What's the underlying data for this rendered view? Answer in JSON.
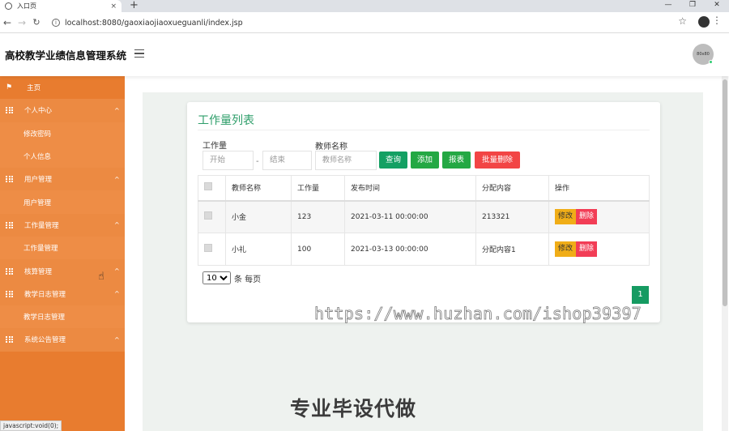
{
  "browser": {
    "tab_title": "入口页",
    "tab_close": "×",
    "new_tab": "+",
    "window_controls": [
      "—",
      "❐",
      "✕"
    ],
    "back": "←",
    "forward": "→",
    "reload": "C",
    "url": "localhost:8080/gaoxiaojiaoxueguanli/index.jsp",
    "star": "☆",
    "menu": "⋮",
    "status_url": "javascript:void(0);"
  },
  "header": {
    "brand": "高校教学业绩信息管理系统",
    "avatar_text": "80x80"
  },
  "sidebar": {
    "items": [
      {
        "label": "主页",
        "type": "parent",
        "icon": "flag-icon"
      },
      {
        "label": "个人中心",
        "type": "parent",
        "icon": "grid-icon",
        "caret": "^"
      },
      {
        "label": "修改密码",
        "type": "child"
      },
      {
        "label": "个人信息",
        "type": "child"
      },
      {
        "label": "用户管理",
        "type": "parent",
        "icon": "grid-icon",
        "caret": "^"
      },
      {
        "label": "用户管理",
        "type": "child"
      },
      {
        "label": "工作量管理",
        "type": "parent",
        "icon": "grid-icon",
        "caret": "^"
      },
      {
        "label": "工作量管理",
        "type": "child"
      },
      {
        "label": "核算管理",
        "type": "parent",
        "icon": "grid-icon",
        "caret": "^"
      },
      {
        "label": "教学日志管理",
        "type": "parent",
        "icon": "grid-icon",
        "caret": "^"
      },
      {
        "label": "教学日志管理",
        "type": "child"
      },
      {
        "label": "系统公告管理",
        "type": "parent",
        "icon": "grid-icon",
        "caret": "^"
      }
    ]
  },
  "card": {
    "title": "工作量列表",
    "filters": {
      "workload_label": "工作量",
      "start_placeholder": "开始",
      "separator": "-",
      "end_placeholder": "结束",
      "teacher_label": "教师名称",
      "teacher_placeholder": "教师名称"
    },
    "buttons": {
      "search": "查询",
      "add": "添加",
      "report": "报表",
      "batch_delete": "批量删除"
    },
    "table": {
      "headers": [
        "教师名称",
        "工作量",
        "发布时间",
        "分配内容",
        "操作"
      ],
      "rows": [
        {
          "teacher": "小金",
          "workload": "123",
          "time": "2021-03-11 00:00:00",
          "content": "213321"
        },
        {
          "teacher": "小礼",
          "workload": "100",
          "time": "2021-03-13 00:00:00",
          "content": "分配内容1"
        }
      ],
      "edit_label": "修改",
      "delete_label": "删除"
    },
    "page_size": "10",
    "page_size_suffix": "条 每页",
    "current_page": "1"
  },
  "overlay": {
    "watermark": "https://www.huzhan.com/ishop39397",
    "promo": "专业毕设代做"
  }
}
